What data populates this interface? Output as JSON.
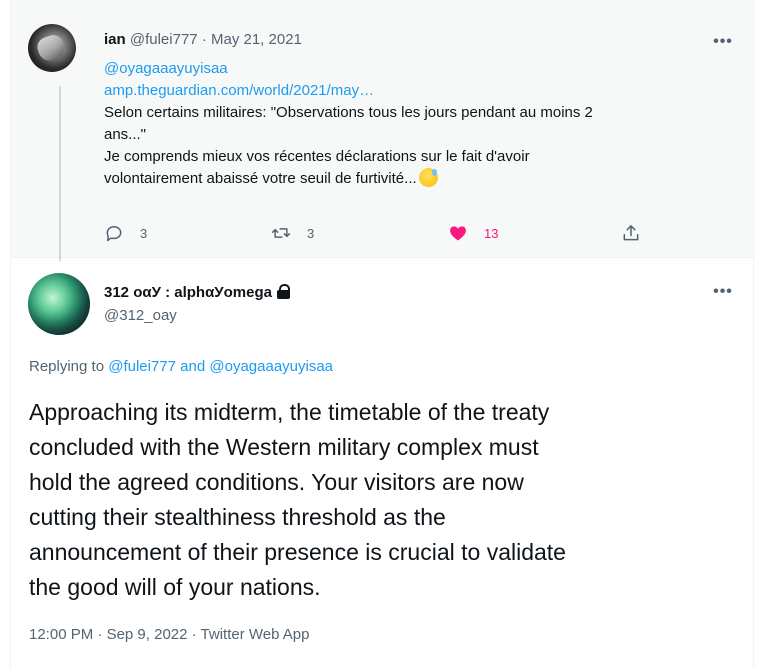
{
  "tweet1": {
    "name": "ian",
    "handle": "@fulei777",
    "separator": "·",
    "date": "May 21, 2021",
    "mention": "@oyagaaayuyisaa",
    "link_text": "amp.theguardian.com/world/2021/may…",
    "line1": "Selon certains militaires: \"Observations tous les jours pendant au moins 2",
    "line2": "ans...\"",
    "line3": "Je comprends mieux vos récentes déclarations sur le fait d'avoir",
    "line4": "volontairement abaissé votre seuil de furtivité...",
    "emoji": "sweat-smile-emoji",
    "replies": "3",
    "retweets": "3",
    "likes": "13",
    "like_color": "#f91880"
  },
  "tweet2": {
    "name": "312 οαУ : alphαУomega",
    "protected_icon": "lock-icon",
    "handle": "@312_oay",
    "replying_prefix": "Replying to",
    "reply_to_1": "@fulei777",
    "and": "and",
    "reply_to_2": "@oyagaaayuyisaa",
    "text_lines": [
      "Approaching its midterm, the timetable of the treaty",
      "concluded with the Western military complex must",
      "hold the agreed conditions. Your visitors are now",
      "cutting their stealthiness threshold as the",
      "announcement of their presence is crucial to validate",
      "the good will of your nations."
    ],
    "time": "12:00 PM",
    "separator": "·",
    "date": "Sep 9, 2022",
    "source": "Twitter Web App"
  },
  "more_label": "•••",
  "colors": {
    "link": "#1d9bf0",
    "secondary": "#536471",
    "text": "#0f1419"
  }
}
